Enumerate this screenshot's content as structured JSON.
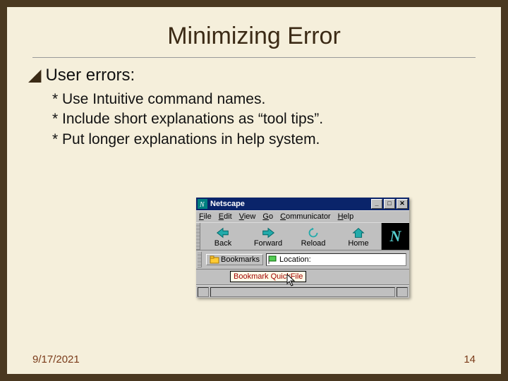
{
  "slide": {
    "title": "Minimizing Error",
    "lead_bullet_glyph": "◢",
    "lead": "User errors:",
    "subs": [
      "Use Intuitive command names.",
      "Include short explanations as “tool tips”.",
      "Put longer explanations in help system."
    ],
    "footer_date": "9/17/2021",
    "footer_page": "14"
  },
  "netscape": {
    "window_title": "Netscape",
    "win_min": "_",
    "win_max": "□",
    "win_close": "✕",
    "menus": {
      "file": {
        "u": "F",
        "rest": "ile"
      },
      "edit": {
        "u": "E",
        "rest": "dit"
      },
      "view": {
        "u": "V",
        "rest": "iew"
      },
      "go": {
        "u": "G",
        "rest": "o"
      },
      "communicator": {
        "u": "C",
        "rest": "ommunicator"
      },
      "help": {
        "u": "H",
        "rest": "elp"
      }
    },
    "toolbar": {
      "back": "Back",
      "forward": "Forward",
      "reload": "Reload",
      "home": "Home",
      "throbber": "N"
    },
    "bookmarks_label": "Bookmarks",
    "location_label": "Location:",
    "tooltip": "Bookmark QuickFile"
  }
}
